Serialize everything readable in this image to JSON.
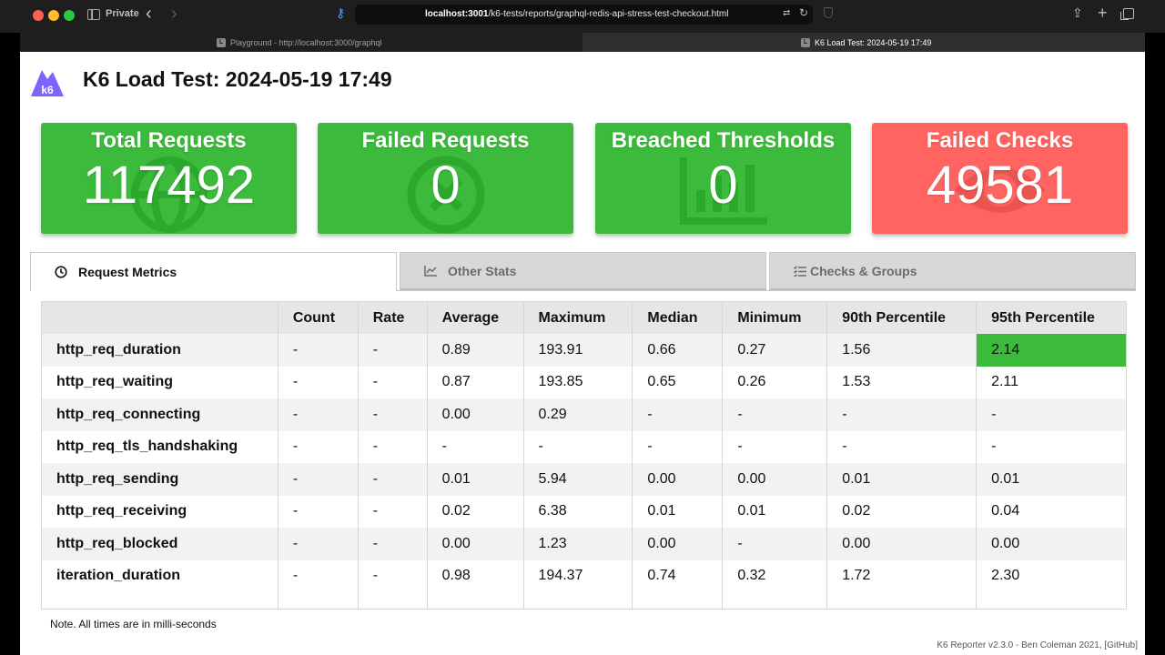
{
  "browser": {
    "private_label": "Private",
    "url_host": "localhost:3001",
    "url_path": "/k6-tests/reports/graphql-redis-api-stress-test-checkout.html",
    "tabs": [
      {
        "favicon": "L",
        "title": "Playground - http://localhost:3000/graphql"
      },
      {
        "favicon": "L",
        "title": "K6 Load Test: 2024-05-19 17:49"
      }
    ]
  },
  "page": {
    "title": "K6 Load Test: 2024-05-19 17:49",
    "logo_text": "k6"
  },
  "cards": [
    {
      "label": "Total Requests",
      "value": "117492",
      "status": "ok",
      "icon": "globe-icon"
    },
    {
      "label": "Failed Requests",
      "value": "0",
      "status": "ok",
      "icon": "circle-x-icon"
    },
    {
      "label": "Breached Thresholds",
      "value": "0",
      "status": "ok",
      "icon": "bar-chart-icon"
    },
    {
      "label": "Failed Checks",
      "value": "49581",
      "status": "fail",
      "icon": "eye-icon"
    }
  ],
  "tabs": [
    {
      "label": "Request Metrics",
      "icon": "clock-icon",
      "active": true
    },
    {
      "label": "Other Stats",
      "icon": "line-chart-icon",
      "active": false
    },
    {
      "label": "Checks & Groups",
      "icon": "list-check-icon",
      "active": false
    }
  ],
  "table": {
    "headers": [
      "",
      "Count",
      "Rate",
      "Average",
      "Maximum",
      "Median",
      "Minimum",
      "90th Percentile",
      "95th Percentile"
    ],
    "rows": [
      [
        "http_req_duration",
        "-",
        "-",
        "0.89",
        "193.91",
        "0.66",
        "0.27",
        "1.56",
        "2.14"
      ],
      [
        "http_req_waiting",
        "-",
        "-",
        "0.87",
        "193.85",
        "0.65",
        "0.26",
        "1.53",
        "2.11"
      ],
      [
        "http_req_connecting",
        "-",
        "-",
        "0.00",
        "0.29",
        "-",
        "-",
        "-",
        "-"
      ],
      [
        "http_req_tls_handshaking",
        "-",
        "-",
        "-",
        "-",
        "-",
        "-",
        "-",
        "-"
      ],
      [
        "http_req_sending",
        "-",
        "-",
        "0.01",
        "5.94",
        "0.00",
        "0.00",
        "0.01",
        "0.01"
      ],
      [
        "http_req_receiving",
        "-",
        "-",
        "0.02",
        "6.38",
        "0.01",
        "0.01",
        "0.02",
        "0.04"
      ],
      [
        "http_req_blocked",
        "-",
        "-",
        "0.00",
        "1.23",
        "0.00",
        "-",
        "0.00",
        "0.00"
      ],
      [
        "iteration_duration",
        "-",
        "-",
        "0.98",
        "194.37",
        "0.74",
        "0.32",
        "1.72",
        "2.30"
      ]
    ],
    "highlight": {
      "row": 0,
      "col": 8,
      "color": "#3cba3c"
    }
  },
  "note": "Note. All times are in milli-seconds",
  "footer": "K6 Reporter v2.3.0 - Ben Coleman 2021, [GitHub]",
  "colors": {
    "ok": "#3cba3c",
    "fail": "#ff6461",
    "logo": "#7d64ff"
  }
}
